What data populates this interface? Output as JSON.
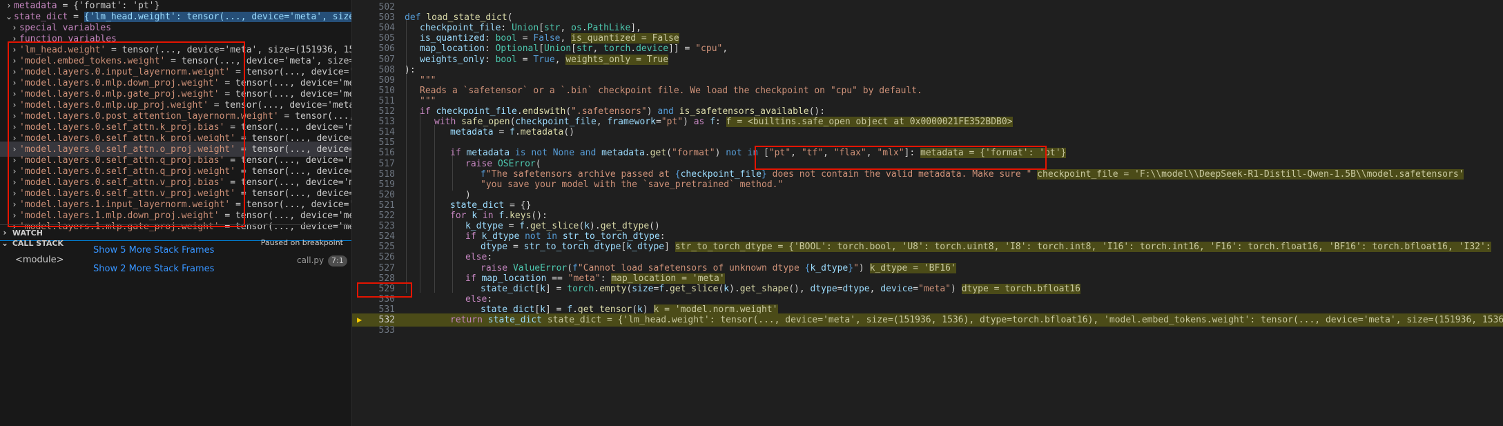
{
  "sidebar": {
    "top_rows": [
      {
        "chevron": ">",
        "name": "metadata",
        "value": "{'format': 'pt'}"
      },
      {
        "chevron": "v",
        "name": "state_dict",
        "value": "{'lm_head.weight': tensor(..., device='meta', size=(..."
      }
    ],
    "groups": [
      {
        "label": "special variables"
      },
      {
        "label": "function variables"
      }
    ],
    "entries": [
      {
        "name": "'lm_head.weight'",
        "value": "tensor(..., device='meta', size=(151936, 1536)..."
      },
      {
        "name": "'model.embed_tokens.weight'",
        "value": "tensor(..., device='meta', size=(15..."
      },
      {
        "name": "'model.layers.0.input_layernorm.weight'",
        "value": "tensor(..., device='met..."
      },
      {
        "name": "'model.layers.0.mlp.down_proj.weight'",
        "value": "tensor(..., device='meta'..."
      },
      {
        "name": "'model.layers.0.mlp.gate_proj.weight'",
        "value": "tensor(..., device='meta'..."
      },
      {
        "name": "'model.layers.0.mlp.up_proj.weight'",
        "value": "tensor(..., device='meta', ..."
      },
      {
        "name": "'model.layers.0.post_attention_layernorm.weight'",
        "value": "tensor(..., de..."
      },
      {
        "name": "'model.layers.0.self_attn.k_proj.bias'",
        "value": "tensor(..., device='meta..."
      },
      {
        "name": "'model.layers.0.self_attn.k_proj.weight'",
        "value": "tensor(..., device='me..."
      },
      {
        "name": "'model.layers.0.self_attn.o_proj.weight'",
        "value": "tensor(..., device='m..."
      },
      {
        "name": "'model.layers.0.self_attn.q_proj.bias'",
        "value": "tensor(..., device='meta..."
      },
      {
        "name": "'model.layers.0.self_attn.q_proj.weight'",
        "value": "tensor(..., device='me..."
      },
      {
        "name": "'model.layers.0.self_attn.v_proj.bias'",
        "value": "tensor(..., device='meta..."
      },
      {
        "name": "'model.layers.0.self_attn.v_proj.weight'",
        "value": "tensor(..., device='me..."
      },
      {
        "name": "'model.layers.1.input_layernorm.weight'",
        "value": "tensor(..., device='met..."
      },
      {
        "name": "'model.layers.1.mlp.down_proj.weight'",
        "value": "tensor(..., device='meta'..."
      },
      {
        "name": "'model.layers.1.mlp.gate_proj.weight'",
        "value": "tensor(..., device='meta'..."
      }
    ],
    "watch": {
      "chevron": ">",
      "label": "WATCH"
    },
    "callstack": {
      "chevron": "v",
      "label": "CALL STACK",
      "status": "Paused on breakpoint",
      "show_more_1": "Show 5 More Stack Frames",
      "module": "<module>",
      "file": "call.py",
      "line": "7:1",
      "show_more_2": "Show 2 More Stack Frames"
    }
  },
  "editor": {
    "lines": [
      {
        "n": "502",
        "indent": 0,
        "segs": []
      },
      {
        "n": "503",
        "indent": 0,
        "segs": [
          [
            "kw",
            "def "
          ],
          [
            "fn",
            "load_state_dict"
          ],
          [
            "pu",
            "("
          ]
        ]
      },
      {
        "n": "504",
        "indent": 1,
        "segs": [
          [
            "pm",
            "checkpoint_file"
          ],
          [
            "pu",
            ": "
          ],
          [
            "ty",
            "Union"
          ],
          [
            "pu",
            "["
          ],
          [
            "ty",
            "str"
          ],
          [
            "pu",
            ", "
          ],
          [
            "ty",
            "os"
          ],
          [
            "pu",
            "."
          ],
          [
            "ty",
            "PathLike"
          ],
          [
            "pu",
            "],"
          ]
        ]
      },
      {
        "n": "505",
        "indent": 1,
        "segs": [
          [
            "pm",
            "is_quantized"
          ],
          [
            "pu",
            ": "
          ],
          [
            "ty",
            "bool"
          ],
          [
            "op",
            " = "
          ],
          [
            "kw",
            "False"
          ],
          [
            "pu",
            ", "
          ],
          [
            "iv",
            "is_quantized = False"
          ]
        ]
      },
      {
        "n": "506",
        "indent": 1,
        "segs": [
          [
            "pm",
            "map_location"
          ],
          [
            "pu",
            ": "
          ],
          [
            "ty",
            "Optional"
          ],
          [
            "pu",
            "["
          ],
          [
            "ty",
            "Union"
          ],
          [
            "pu",
            "["
          ],
          [
            "ty",
            "str"
          ],
          [
            "pu",
            ", "
          ],
          [
            "ty",
            "torch"
          ],
          [
            "pu",
            "."
          ],
          [
            "ty",
            "device"
          ],
          [
            "pu",
            "]]"
          ],
          [
            "op",
            " = "
          ],
          [
            "st",
            "\"cpu\""
          ],
          [
            "pu",
            ","
          ]
        ]
      },
      {
        "n": "507",
        "indent": 1,
        "segs": [
          [
            "pm",
            "weights_only"
          ],
          [
            "pu",
            ": "
          ],
          [
            "ty",
            "bool"
          ],
          [
            "op",
            " = "
          ],
          [
            "kw",
            "True"
          ],
          [
            "pu",
            ", "
          ],
          [
            "iv",
            "weights_only = True"
          ]
        ]
      },
      {
        "n": "508",
        "indent": 0,
        "segs": [
          [
            "pu",
            "):"
          ]
        ]
      },
      {
        "n": "509",
        "indent": 1,
        "segs": [
          [
            "st",
            "\"\"\""
          ]
        ]
      },
      {
        "n": "510",
        "indent": 1,
        "segs": [
          [
            "st",
            "Reads a `safetensor` or a `.bin` checkpoint file. We load the checkpoint on \"cpu\" by default."
          ]
        ]
      },
      {
        "n": "511",
        "indent": 1,
        "segs": [
          [
            "st",
            "\"\"\""
          ]
        ]
      },
      {
        "n": "512",
        "indent": 1,
        "segs": [
          [
            "kc",
            "if "
          ],
          [
            "pm",
            "checkpoint_file"
          ],
          [
            "pu",
            "."
          ],
          [
            "fn",
            "endswith"
          ],
          [
            "pu",
            "("
          ],
          [
            "st",
            "\".safetensors\""
          ],
          [
            "pu",
            ")"
          ],
          [
            "kw",
            " and "
          ],
          [
            "fn",
            "is_safetensors_available"
          ],
          [
            "pu",
            "():"
          ]
        ]
      },
      {
        "n": "513",
        "indent": 2,
        "segs": [
          [
            "kc",
            "with "
          ],
          [
            "fn",
            "safe_open"
          ],
          [
            "pu",
            "("
          ],
          [
            "pm",
            "checkpoint_file"
          ],
          [
            "pu",
            ", "
          ],
          [
            "pm",
            "framework"
          ],
          [
            "op",
            "="
          ],
          [
            "st",
            "\"pt\""
          ],
          [
            "pu",
            ") "
          ],
          [
            "kc",
            "as "
          ],
          [
            "pm",
            "f"
          ],
          [
            "pu",
            ": "
          ],
          [
            "iv",
            "f = <builtins.safe_open object at 0x0000021FE352BDB0>"
          ]
        ]
      },
      {
        "n": "514",
        "indent": 3,
        "segs": [
          [
            "pm",
            "metadata"
          ],
          [
            "op",
            " = "
          ],
          [
            "pm",
            "f"
          ],
          [
            "pu",
            "."
          ],
          [
            "fn",
            "metadata"
          ],
          [
            "pu",
            "()"
          ]
        ]
      },
      {
        "n": "515",
        "indent": 0,
        "segs": []
      },
      {
        "n": "516",
        "indent": 3,
        "segs": [
          [
            "kc",
            "if "
          ],
          [
            "pm",
            "metadata"
          ],
          [
            "kw",
            " is not None and "
          ],
          [
            "pm",
            "metadata"
          ],
          [
            "pu",
            "."
          ],
          [
            "fn",
            "get"
          ],
          [
            "pu",
            "("
          ],
          [
            "st",
            "\"format\""
          ],
          [
            "pu",
            ") "
          ],
          [
            "kw",
            "not in "
          ],
          [
            "pu",
            "["
          ],
          [
            "st",
            "\"pt\""
          ],
          [
            "pu",
            ", "
          ],
          [
            "st",
            "\"tf\""
          ],
          [
            "pu",
            ", "
          ],
          [
            "st",
            "\"flax\""
          ],
          [
            "pu",
            ", "
          ],
          [
            "st",
            "\"mlx\""
          ],
          [
            "pu",
            "]: "
          ],
          [
            "iv",
            "metadata = {'format': 'pt'}"
          ]
        ]
      },
      {
        "n": "517",
        "indent": 4,
        "segs": [
          [
            "kc",
            "raise "
          ],
          [
            "ty",
            "OSError"
          ],
          [
            "pu",
            "("
          ]
        ]
      },
      {
        "n": "518",
        "indent": 5,
        "segs": [
          [
            "kw",
            "f"
          ],
          [
            "st",
            "\"The safetensors archive passed at "
          ],
          [
            "kw",
            "{"
          ],
          [
            "pm",
            "checkpoint_file"
          ],
          [
            "kw",
            "}"
          ],
          [
            "st",
            " does not contain the valid metadata. Make sure \" "
          ],
          [
            "iv",
            "checkpoint_file = 'F:\\\\model\\\\DeepSeek-R1-Distill-Qwen-1.5B\\\\model.safetensors'"
          ]
        ]
      },
      {
        "n": "519",
        "indent": 5,
        "segs": [
          [
            "st",
            "\"you save your model with the `save_pretrained` method.\""
          ]
        ]
      },
      {
        "n": "520",
        "indent": 4,
        "segs": [
          [
            "pu",
            ")"
          ]
        ]
      },
      {
        "n": "521",
        "indent": 3,
        "segs": [
          [
            "pm",
            "state_dict"
          ],
          [
            "op",
            " = "
          ],
          [
            "pu",
            "{}"
          ]
        ]
      },
      {
        "n": "522",
        "indent": 3,
        "segs": [
          [
            "kc",
            "for "
          ],
          [
            "pm",
            "k"
          ],
          [
            "kc",
            " in "
          ],
          [
            "pm",
            "f"
          ],
          [
            "pu",
            "."
          ],
          [
            "fn",
            "keys"
          ],
          [
            "pu",
            "():"
          ]
        ]
      },
      {
        "n": "523",
        "indent": 4,
        "segs": [
          [
            "pm",
            "k_dtype"
          ],
          [
            "op",
            " = "
          ],
          [
            "pm",
            "f"
          ],
          [
            "pu",
            "."
          ],
          [
            "fn",
            "get_slice"
          ],
          [
            "pu",
            "("
          ],
          [
            "pm",
            "k"
          ],
          [
            "pu",
            ")."
          ],
          [
            "fn",
            "get_dtype"
          ],
          [
            "pu",
            "()"
          ]
        ]
      },
      {
        "n": "524",
        "indent": 4,
        "segs": [
          [
            "kc",
            "if "
          ],
          [
            "pm",
            "k_dtype"
          ],
          [
            "kw",
            " not in "
          ],
          [
            "pm",
            "str_to_torch_dtype"
          ],
          [
            "pu",
            ":"
          ]
        ]
      },
      {
        "n": "525",
        "indent": 5,
        "segs": [
          [
            "pm",
            "dtype"
          ],
          [
            "op",
            " = "
          ],
          [
            "pm",
            "str_to_torch_dtype"
          ],
          [
            "pu",
            "["
          ],
          [
            "pm",
            "k_dtype"
          ],
          [
            "pu",
            "] "
          ],
          [
            "iv",
            "str_to_torch_dtype = {'BOOL': torch.bool, 'U8': torch.uint8, 'I8': torch.int8, 'I16': torch.int16, 'F16': torch.float16, 'BF16': torch.bfloat16, 'I32':"
          ]
        ]
      },
      {
        "n": "526",
        "indent": 4,
        "segs": [
          [
            "kc",
            "else"
          ],
          [
            "pu",
            ":"
          ]
        ]
      },
      {
        "n": "527",
        "indent": 5,
        "segs": [
          [
            "kc",
            "raise "
          ],
          [
            "ty",
            "ValueError"
          ],
          [
            "pu",
            "("
          ],
          [
            "kw",
            "f"
          ],
          [
            "st",
            "\"Cannot load safetensors of unknown dtype "
          ],
          [
            "kw",
            "{"
          ],
          [
            "pm",
            "k_dtype"
          ],
          [
            "kw",
            "}"
          ],
          [
            "st",
            "\""
          ],
          [
            "pu",
            ") "
          ],
          [
            "iv",
            "k_dtype = 'BF16'"
          ]
        ]
      },
      {
        "n": "528",
        "indent": 4,
        "segs": [
          [
            "kc",
            "if "
          ],
          [
            "pm",
            "map_location"
          ],
          [
            "op",
            " == "
          ],
          [
            "st",
            "\"meta\""
          ],
          [
            "pu",
            ": "
          ],
          [
            "iv",
            "map_location = 'meta'"
          ]
        ]
      },
      {
        "n": "529",
        "indent": 5,
        "segs": [
          [
            "pm",
            "state_dict"
          ],
          [
            "pu",
            "["
          ],
          [
            "pm",
            "k"
          ],
          [
            "pu",
            "]"
          ],
          [
            "op",
            " = "
          ],
          [
            "ty",
            "torch"
          ],
          [
            "pu",
            "."
          ],
          [
            "fn",
            "empty"
          ],
          [
            "pu",
            "("
          ],
          [
            "pm",
            "size"
          ],
          [
            "op",
            "="
          ],
          [
            "pm",
            "f"
          ],
          [
            "pu",
            "."
          ],
          [
            "fn",
            "get_slice"
          ],
          [
            "pu",
            "("
          ],
          [
            "pm",
            "k"
          ],
          [
            "pu",
            ")."
          ],
          [
            "fn",
            "get_shape"
          ],
          [
            "pu",
            "(), "
          ],
          [
            "pm",
            "dtype"
          ],
          [
            "op",
            "="
          ],
          [
            "pm",
            "dtype"
          ],
          [
            "pu",
            ", "
          ],
          [
            "pm",
            "device"
          ],
          [
            "op",
            "="
          ],
          [
            "st",
            "\"meta\""
          ],
          [
            "pu",
            ") "
          ],
          [
            "iv",
            "dtype = torch.bfloat16"
          ]
        ]
      },
      {
        "n": "530",
        "indent": 4,
        "segs": [
          [
            "kc",
            "else"
          ],
          [
            "pu",
            ":"
          ]
        ]
      },
      {
        "n": "531",
        "indent": 5,
        "segs": [
          [
            "pm",
            "state_dict"
          ],
          [
            "pu",
            "["
          ],
          [
            "pm",
            "k"
          ],
          [
            "pu",
            "]"
          ],
          [
            "op",
            " = "
          ],
          [
            "pm",
            "f"
          ],
          [
            "pu",
            "."
          ],
          [
            "fn",
            "get_tensor"
          ],
          [
            "pu",
            "("
          ],
          [
            "pm",
            "k"
          ],
          [
            "pu",
            ") "
          ],
          [
            "iv",
            "k = 'model.norm.weight'"
          ]
        ]
      },
      {
        "n": "532",
        "indent": 3,
        "current": true,
        "segs": [
          [
            "kc",
            "return "
          ],
          [
            "pm",
            "state_dict"
          ],
          [
            "pu",
            " "
          ],
          [
            "iv",
            "state_dict = {'lm_head.weight': tensor(..., device='meta', size=(151936, 1536), dtype=torch.bfloat16), 'model.embed_tokens.weight': tensor(..., device='meta', size=(151936, 1536"
          ]
        ]
      },
      {
        "n": "533",
        "indent": 0,
        "segs": []
      }
    ]
  },
  "colors": {
    "highlight_box": "#e51400",
    "current_line": "#4b4b18",
    "link": "#3794ff",
    "breakpoint_arrow": "#ffcc00"
  },
  "icons": [
    "chevron-right-icon",
    "chevron-down-icon",
    "breakpoint-arrow-icon"
  ]
}
